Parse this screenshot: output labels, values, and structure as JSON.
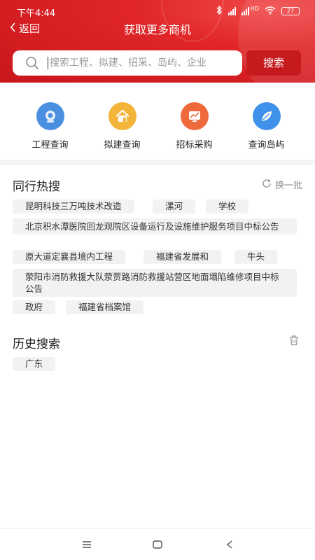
{
  "status": {
    "time": "下午4:44",
    "battery": "27",
    "network_label": "HD"
  },
  "nav": {
    "back_label": "返回",
    "title": "获取更多商机"
  },
  "search": {
    "placeholder": "搜索工程、拟建、招采、岛屿、企业",
    "button_label": "搜索"
  },
  "quick_nav": [
    {
      "label": "工程查询",
      "icon": "camera-icon",
      "color": "#4a8fe0"
    },
    {
      "label": "拟建查询",
      "icon": "house-icon",
      "color": "#f2b53a"
    },
    {
      "label": "招标采购",
      "icon": "chart-icon",
      "color": "#ee6a3d"
    },
    {
      "label": "查询岛屿",
      "icon": "leaf-icon",
      "color": "#3f91ea"
    }
  ],
  "hot": {
    "title": "同行热搜",
    "refresh_label": "换一批",
    "tags": [
      "昆明科技三万吨技术改造",
      "漯河",
      "学校",
      "北京积水潭医院回龙观院区设备运行及设施维护服务项目中标公告",
      "原大道定襄县境内工程",
      "福建省发展和",
      "牛头",
      "荥阳市消防救援大队荥贾路消防救援站营区地面塌陷维修项目中标公告",
      "政府",
      "福建省档案馆"
    ]
  },
  "history": {
    "title": "历史搜索",
    "tags": [
      "广东"
    ]
  },
  "colors": {
    "brand_red": "#d91f24",
    "button_red": "#c61a1e",
    "tag_bg": "#f2f2f2"
  }
}
